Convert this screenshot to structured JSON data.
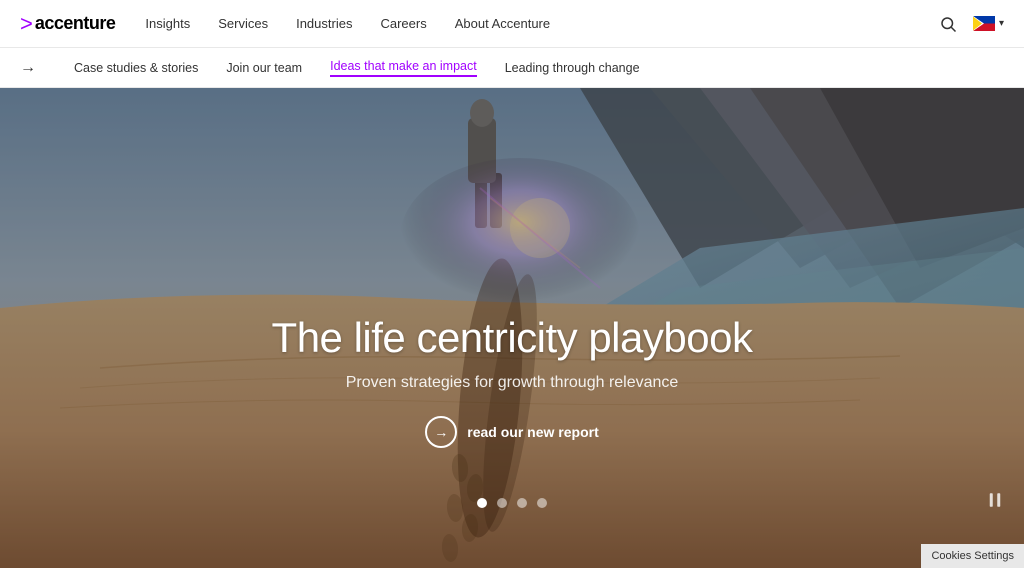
{
  "logo": {
    "text": "accenture",
    "accent_char": ">"
  },
  "navbar": {
    "links": [
      {
        "label": "Insights",
        "id": "insights"
      },
      {
        "label": "Services",
        "id": "services"
      },
      {
        "label": "Industries",
        "id": "industries"
      },
      {
        "label": "Careers",
        "id": "careers"
      },
      {
        "label": "About Accenture",
        "id": "about"
      }
    ],
    "search_label": "Search",
    "country": "PH"
  },
  "subnav": {
    "arrow": "→",
    "links": [
      {
        "label": "Case studies & stories",
        "active": false
      },
      {
        "label": "Join our team",
        "active": false
      },
      {
        "label": "Ideas that make an impact",
        "active": true
      },
      {
        "label": "Leading through change",
        "active": false
      }
    ]
  },
  "hero": {
    "title": "The life centricity playbook",
    "subtitle": "Proven strategies for growth through relevance",
    "cta_label": "read our new report",
    "cta_arrow": "→",
    "dots": [
      {
        "active": true
      },
      {
        "active": false
      },
      {
        "active": false
      },
      {
        "active": false
      }
    ]
  },
  "cookies": {
    "label": "Cookies Settings"
  },
  "icons": {
    "search": "🔍",
    "pause": "⏸",
    "chevron_down": "▾"
  }
}
